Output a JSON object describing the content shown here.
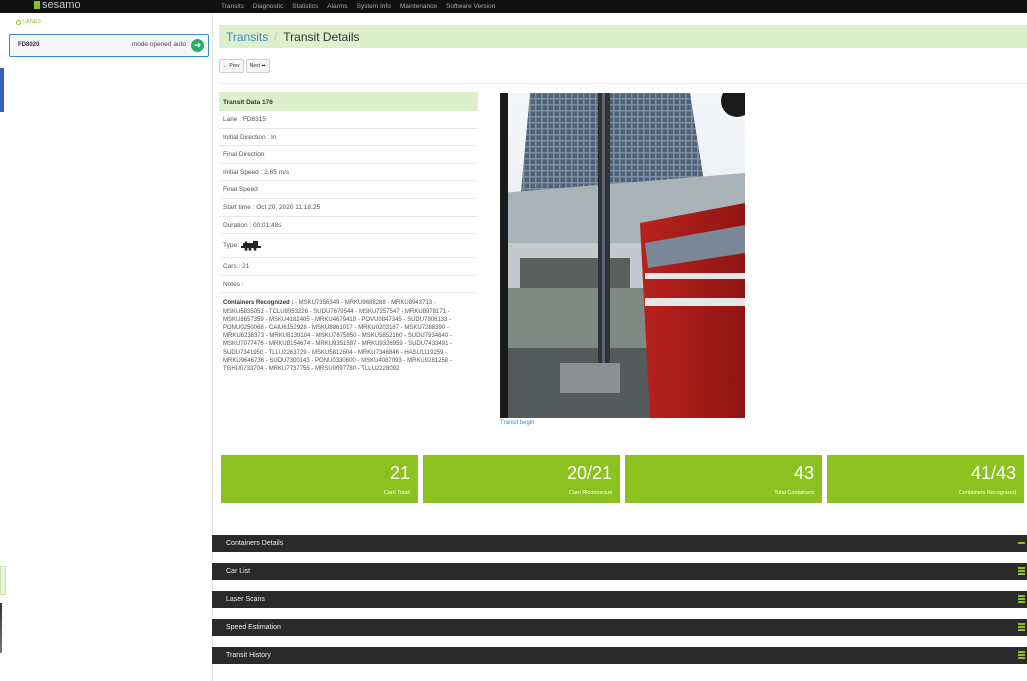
{
  "app": {
    "brand": "sesamo",
    "brand_color": "#8cc21f"
  },
  "nav": {
    "links": [
      "Transits",
      "Diagnostic",
      "Statistics",
      "Alarms",
      "System Info",
      "Maintenance",
      "Software Version"
    ]
  },
  "sidebar": {
    "lanes_label": "LANES",
    "lane": {
      "name": "FD8020",
      "mode": "mode opened auto"
    }
  },
  "breadcrumb": {
    "parent": "Transits",
    "sep": "/",
    "current": "Transit Details"
  },
  "pager": {
    "prev": "← Prev",
    "next": "Next ➡"
  },
  "transit": {
    "header": "Transit Data 176",
    "lane": "Lane : FD8315",
    "initial_direction": "Initial Direction : In",
    "final_direction": "Final Direction",
    "initial_speed": "Initial Speed : 2,65 m/s",
    "final_speed": "Final Speed",
    "start_time": "Start time : Oct 20, 2020 11:18:25",
    "duration": "Duration : 00:01:48s",
    "type_label": "Type:",
    "type_icon": "locomotive-icon",
    "cars": "Cars : 21",
    "notes": "Notes :",
    "containers_label": "Containers Recognized :",
    "containers_text": "- MSKU7356349 - MRKU9688288 - MRKU8943713 - MSKU5835051 - TCLU8953226 - SUDU7679544 - MSKU7257547 - MRKU8978171 - MSKU8657359 - MSKU4182405 - MRKU4679418 - POVU0847345 - SUDU7806133 - PONU0250068 - CAIU6152928 - MSKU8861017 - MRKU0203187 - MSKU7288390 - MRKU6238373 - MRKU8139104 - MSKU7675850 - MSKU5852160 - SUDU7934640 - MSKU7077476 - MRKU8154674 - MRKU9351587 - MRKU9326959 - SUDU7433491 - SUDU7341950 - TLLU2263729 - MSKU5812604 - MRKU7346846 - HASU1119259 - MRKU9646736 - SUDU7300143 - PONU0330600 - MSKU4087093 - MRKU9281258 - TGHU0733704 - MRKU7737755 - MRSU0097780 - TLLU2228092"
  },
  "photo": {
    "caption": "Transit begin"
  },
  "stats": [
    {
      "value": "21",
      "label": "Carri Totali"
    },
    {
      "value": "20/21",
      "label": "Carri Riconosciuti"
    },
    {
      "value": "43",
      "label": "Total Containers"
    },
    {
      "value": "41/43",
      "label": "Containers Recognized"
    }
  ],
  "sections": [
    {
      "title": "Containers Details",
      "toggle": "minus"
    },
    {
      "title": "Car List",
      "toggle": "bars"
    },
    {
      "title": "Laser Scans",
      "toggle": "bars"
    },
    {
      "title": "Speed Estimation",
      "toggle": "bars"
    },
    {
      "title": "Transit History",
      "toggle": "bars"
    }
  ]
}
